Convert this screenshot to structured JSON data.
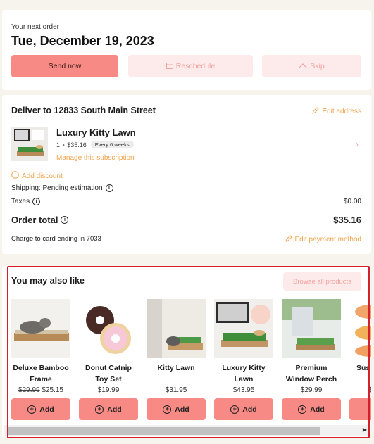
{
  "next_order": {
    "label": "Your next order",
    "date": "Tue, December 19, 2023",
    "send_now": "Send now",
    "reschedule": "Reschedule",
    "skip": "Skip"
  },
  "delivery": {
    "title": "Deliver to 12833 South Main Street",
    "edit_address": "Edit address",
    "product": {
      "name": "Luxury Kitty Lawn",
      "qty_price": "1 × $35.16",
      "frequency": "Every 6 weeks",
      "manage": "Manage this subscription"
    },
    "add_discount": "Add discount",
    "shipping": "Shipping: Pending estimation",
    "taxes_label": "Taxes",
    "taxes_value": "$0.00",
    "total_label": "Order total",
    "total_value": "$35.16",
    "card_text": "Charge to card ending in 7033",
    "edit_payment": "Edit payment method"
  },
  "upsell": {
    "title": "You may also like",
    "browse": "Browse all products",
    "add_label": "Add",
    "items": [
      {
        "name": "Deluxe Bamboo Frame",
        "old_price": "$29.99",
        "price": "$25.15"
      },
      {
        "name": "Donut Catnip Toy Set",
        "old_price": "",
        "price": "$19.99"
      },
      {
        "name": "Kitty Lawn",
        "old_price": "",
        "price": "$31.95"
      },
      {
        "name": "Luxury Kitty Lawn",
        "old_price": "",
        "price": "$43.95"
      },
      {
        "name": "Premium Window Perch",
        "old_price": "",
        "price": "$29.99"
      },
      {
        "name": "Sus T",
        "old_price": "",
        "price": "$"
      }
    ]
  },
  "colors": {
    "accent": "#f78a85",
    "accent_soft": "#fdebeb",
    "link": "#f0a34a",
    "highlight_border": "#d71e2b"
  }
}
